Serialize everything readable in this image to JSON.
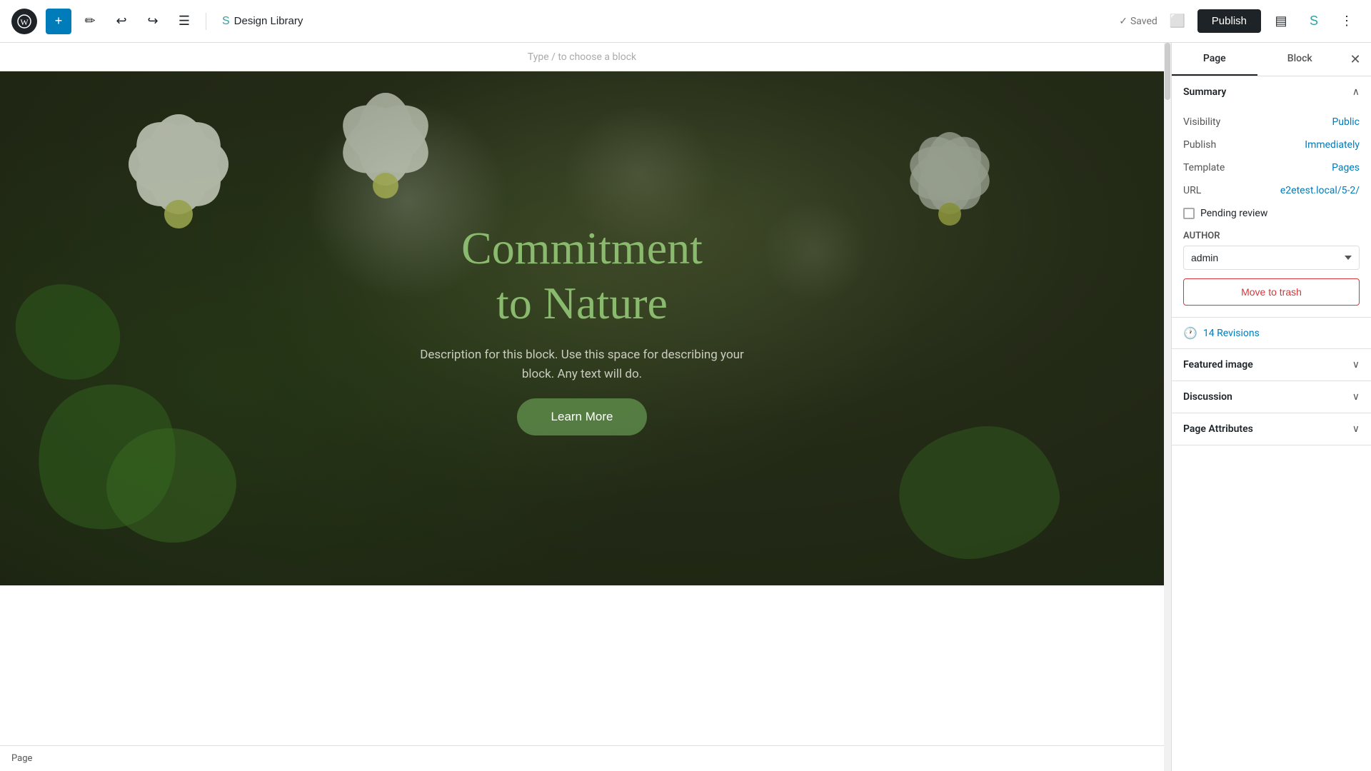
{
  "toolbar": {
    "wp_logo": "W",
    "add_label": "+",
    "tools_label": "✏",
    "undo_label": "↩",
    "redo_label": "↪",
    "list_view_label": "☰",
    "design_library_label": "Design Library",
    "design_library_icon": "S",
    "saved_label": "Saved",
    "publish_label": "Publish",
    "view_label": "⬜",
    "storybook_label": "S",
    "more_label": "⋮"
  },
  "editor": {
    "block_hint": "Type / to choose a block",
    "footer_label": "Page"
  },
  "hero": {
    "title_line1": "Commitment",
    "title_line2": "to Nature",
    "description": "Description for this block. Use this space for describing your block. Any text will do.",
    "button_label": "Learn More"
  },
  "sidebar": {
    "tab_page": "Page",
    "tab_block": "Block",
    "close_icon": "✕",
    "summary": {
      "title": "Summary",
      "visibility_label": "Visibility",
      "visibility_value": "Public",
      "publish_label": "Publish",
      "publish_value": "Immediately",
      "template_label": "Template",
      "template_value": "Pages",
      "url_label": "URL",
      "url_value": "e2etest.local/5-2/",
      "pending_review_label": "Pending review",
      "author_label": "AUTHOR",
      "author_value": "admin",
      "move_to_trash_label": "Move to trash"
    },
    "revisions": {
      "icon": "🕐",
      "label": "14 Revisions"
    },
    "featured_image": {
      "title": "Featured image"
    },
    "discussion": {
      "title": "Discussion"
    },
    "page_attributes": {
      "title": "Page Attributes"
    }
  }
}
